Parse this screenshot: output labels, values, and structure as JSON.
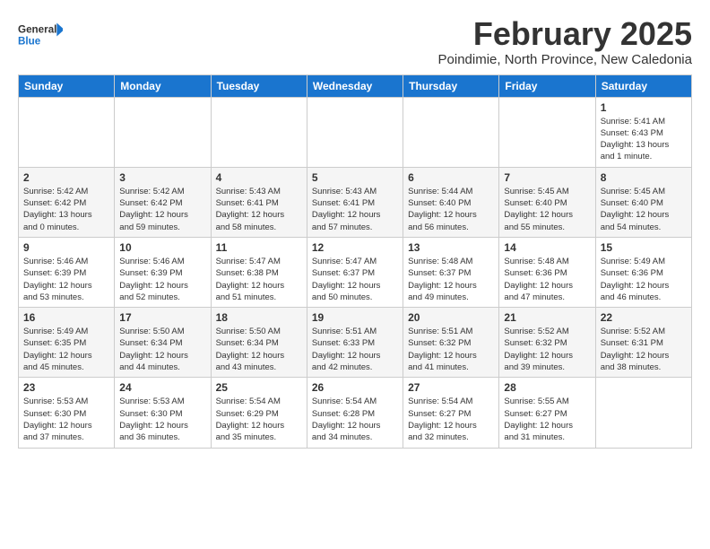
{
  "logo": {
    "line1": "General",
    "line2": "Blue"
  },
  "title": "February 2025",
  "subtitle": "Poindimie, North Province, New Caledonia",
  "weekdays": [
    "Sunday",
    "Monday",
    "Tuesday",
    "Wednesday",
    "Thursday",
    "Friday",
    "Saturday"
  ],
  "weeks": [
    [
      {
        "day": "",
        "info": ""
      },
      {
        "day": "",
        "info": ""
      },
      {
        "day": "",
        "info": ""
      },
      {
        "day": "",
        "info": ""
      },
      {
        "day": "",
        "info": ""
      },
      {
        "day": "",
        "info": ""
      },
      {
        "day": "1",
        "info": "Sunrise: 5:41 AM\nSunset: 6:43 PM\nDaylight: 13 hours\nand 1 minute."
      }
    ],
    [
      {
        "day": "2",
        "info": "Sunrise: 5:42 AM\nSunset: 6:42 PM\nDaylight: 13 hours\nand 0 minutes."
      },
      {
        "day": "3",
        "info": "Sunrise: 5:42 AM\nSunset: 6:42 PM\nDaylight: 12 hours\nand 59 minutes."
      },
      {
        "day": "4",
        "info": "Sunrise: 5:43 AM\nSunset: 6:41 PM\nDaylight: 12 hours\nand 58 minutes."
      },
      {
        "day": "5",
        "info": "Sunrise: 5:43 AM\nSunset: 6:41 PM\nDaylight: 12 hours\nand 57 minutes."
      },
      {
        "day": "6",
        "info": "Sunrise: 5:44 AM\nSunset: 6:40 PM\nDaylight: 12 hours\nand 56 minutes."
      },
      {
        "day": "7",
        "info": "Sunrise: 5:45 AM\nSunset: 6:40 PM\nDaylight: 12 hours\nand 55 minutes."
      },
      {
        "day": "8",
        "info": "Sunrise: 5:45 AM\nSunset: 6:40 PM\nDaylight: 12 hours\nand 54 minutes."
      }
    ],
    [
      {
        "day": "9",
        "info": "Sunrise: 5:46 AM\nSunset: 6:39 PM\nDaylight: 12 hours\nand 53 minutes."
      },
      {
        "day": "10",
        "info": "Sunrise: 5:46 AM\nSunset: 6:39 PM\nDaylight: 12 hours\nand 52 minutes."
      },
      {
        "day": "11",
        "info": "Sunrise: 5:47 AM\nSunset: 6:38 PM\nDaylight: 12 hours\nand 51 minutes."
      },
      {
        "day": "12",
        "info": "Sunrise: 5:47 AM\nSunset: 6:37 PM\nDaylight: 12 hours\nand 50 minutes."
      },
      {
        "day": "13",
        "info": "Sunrise: 5:48 AM\nSunset: 6:37 PM\nDaylight: 12 hours\nand 49 minutes."
      },
      {
        "day": "14",
        "info": "Sunrise: 5:48 AM\nSunset: 6:36 PM\nDaylight: 12 hours\nand 47 minutes."
      },
      {
        "day": "15",
        "info": "Sunrise: 5:49 AM\nSunset: 6:36 PM\nDaylight: 12 hours\nand 46 minutes."
      }
    ],
    [
      {
        "day": "16",
        "info": "Sunrise: 5:49 AM\nSunset: 6:35 PM\nDaylight: 12 hours\nand 45 minutes."
      },
      {
        "day": "17",
        "info": "Sunrise: 5:50 AM\nSunset: 6:34 PM\nDaylight: 12 hours\nand 44 minutes."
      },
      {
        "day": "18",
        "info": "Sunrise: 5:50 AM\nSunset: 6:34 PM\nDaylight: 12 hours\nand 43 minutes."
      },
      {
        "day": "19",
        "info": "Sunrise: 5:51 AM\nSunset: 6:33 PM\nDaylight: 12 hours\nand 42 minutes."
      },
      {
        "day": "20",
        "info": "Sunrise: 5:51 AM\nSunset: 6:32 PM\nDaylight: 12 hours\nand 41 minutes."
      },
      {
        "day": "21",
        "info": "Sunrise: 5:52 AM\nSunset: 6:32 PM\nDaylight: 12 hours\nand 39 minutes."
      },
      {
        "day": "22",
        "info": "Sunrise: 5:52 AM\nSunset: 6:31 PM\nDaylight: 12 hours\nand 38 minutes."
      }
    ],
    [
      {
        "day": "23",
        "info": "Sunrise: 5:53 AM\nSunset: 6:30 PM\nDaylight: 12 hours\nand 37 minutes."
      },
      {
        "day": "24",
        "info": "Sunrise: 5:53 AM\nSunset: 6:30 PM\nDaylight: 12 hours\nand 36 minutes."
      },
      {
        "day": "25",
        "info": "Sunrise: 5:54 AM\nSunset: 6:29 PM\nDaylight: 12 hours\nand 35 minutes."
      },
      {
        "day": "26",
        "info": "Sunrise: 5:54 AM\nSunset: 6:28 PM\nDaylight: 12 hours\nand 34 minutes."
      },
      {
        "day": "27",
        "info": "Sunrise: 5:54 AM\nSunset: 6:27 PM\nDaylight: 12 hours\nand 32 minutes."
      },
      {
        "day": "28",
        "info": "Sunrise: 5:55 AM\nSunset: 6:27 PM\nDaylight: 12 hours\nand 31 minutes."
      },
      {
        "day": "",
        "info": ""
      }
    ]
  ]
}
